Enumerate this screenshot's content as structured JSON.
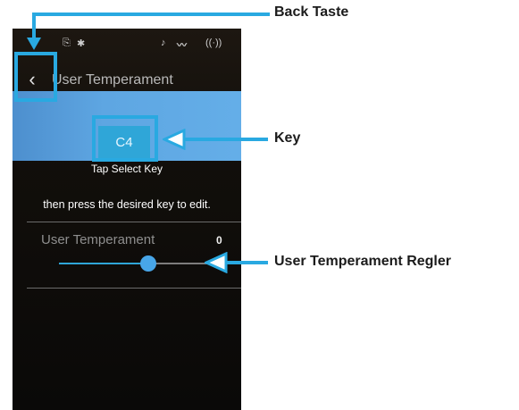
{
  "screen": {
    "title": "User Temperament",
    "key_value": "C4",
    "tap_text": "Tap Select Key",
    "hint_text": "then press the desired key to edit.",
    "slider_label": "User Temperament",
    "slider_value": "0",
    "slider_position_fraction": 0.5
  },
  "callouts": {
    "back": "Back Taste",
    "key": "Key",
    "slider": "User Temperament Regler"
  },
  "colors": {
    "accent": "#29a9e1",
    "band": "#5ea6e2",
    "background": "#0a0908"
  },
  "icons": [
    "usb-icon",
    "bluetooth-icon",
    "bluetooth-audio-icon",
    "midi-wave-icon",
    "wireless-icon",
    "back-chevron-icon"
  ]
}
